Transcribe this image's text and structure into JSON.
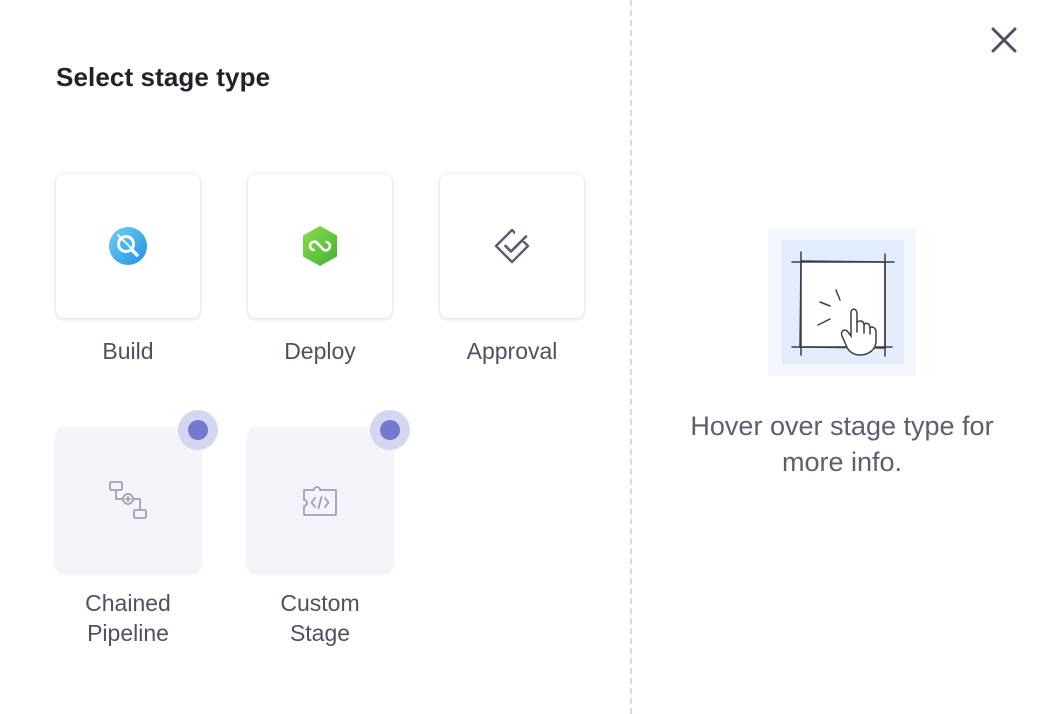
{
  "dialog": {
    "title": "Select stage type",
    "close_icon": "close-icon"
  },
  "stages": [
    {
      "label": "Build",
      "icon": "ci-build-icon",
      "disabled": false
    },
    {
      "label": "Deploy",
      "icon": "cd-deploy-icon",
      "disabled": false
    },
    {
      "label": "Approval",
      "icon": "approval-check-icon",
      "disabled": false
    },
    {
      "label_line1": "Chained",
      "label_line2": "Pipeline",
      "icon": "chained-pipeline-icon",
      "disabled": true,
      "badge": "feature-badge"
    },
    {
      "label_line1": "Custom",
      "label_line2": "Stage",
      "icon": "custom-stage-icon",
      "disabled": true,
      "badge": "feature-badge"
    }
  ],
  "info_panel": {
    "illustration": "hover-hand-illustration",
    "hint_line1": "Hover over stage type for",
    "hint_line2": "more info."
  },
  "colors": {
    "title": "#22222a",
    "label": "#4f5162",
    "badge_ring": "#d3d6ee",
    "badge_dot": "#7479cf",
    "build_blue": "#2ea2ea",
    "deploy_green": "#53c232",
    "divider": "#d9dae5"
  }
}
